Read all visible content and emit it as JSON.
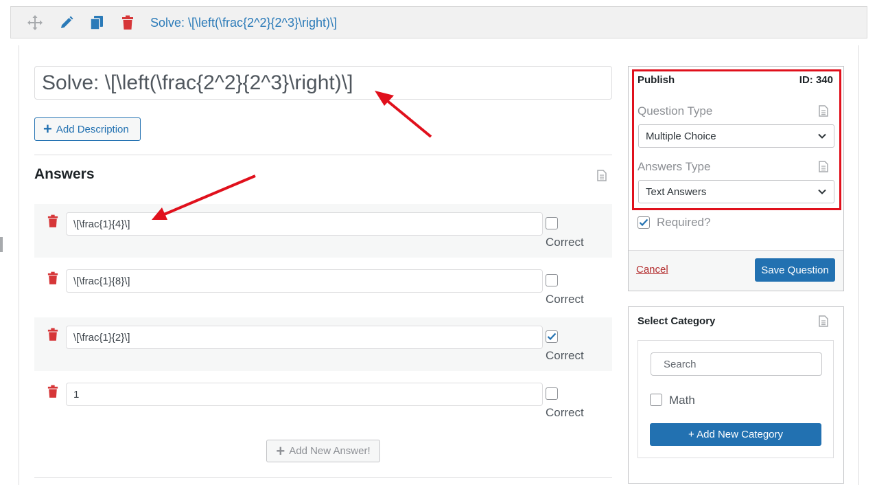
{
  "toolbar": {
    "title": "Solve: \\[\\left(\\frac{2^2}{2^3}\\right)\\]",
    "icons": [
      "move-icon",
      "edit-icon",
      "copy-icon",
      "trash-icon"
    ]
  },
  "question": {
    "title_value": "Solve: \\[\\left(\\frac{2^2}{2^3}\\right)\\]",
    "add_description_label": "Add Description"
  },
  "answers": {
    "heading": "Answers",
    "correct_label": "Correct",
    "items": [
      {
        "value": "\\[\\frac{1}{4}\\]",
        "correct": false
      },
      {
        "value": "\\[\\frac{1}{8}\\]",
        "correct": false
      },
      {
        "value": "\\[\\frac{1}{2}\\]",
        "correct": true
      },
      {
        "value": "1",
        "correct": false
      }
    ],
    "add_answer_label": "Add New Answer!"
  },
  "publish": {
    "title": "Publish",
    "id_label": "ID: 340",
    "question_type_label": "Question Type",
    "question_type_value": "Multiple Choice",
    "answers_type_label": "Answers Type",
    "answers_type_value": "Text Answers",
    "required_label": "Required?",
    "required_checked": true,
    "cancel_label": "Cancel",
    "save_label": "Save Question"
  },
  "category": {
    "title": "Select Category",
    "search_placeholder": "Search",
    "items": [
      {
        "label": "Math",
        "checked": false
      }
    ],
    "add_label": "+ Add New Category"
  },
  "colors": {
    "accent": "#2271b1",
    "annotation_red": "#e0101c",
    "trash_red": "#d63638"
  }
}
